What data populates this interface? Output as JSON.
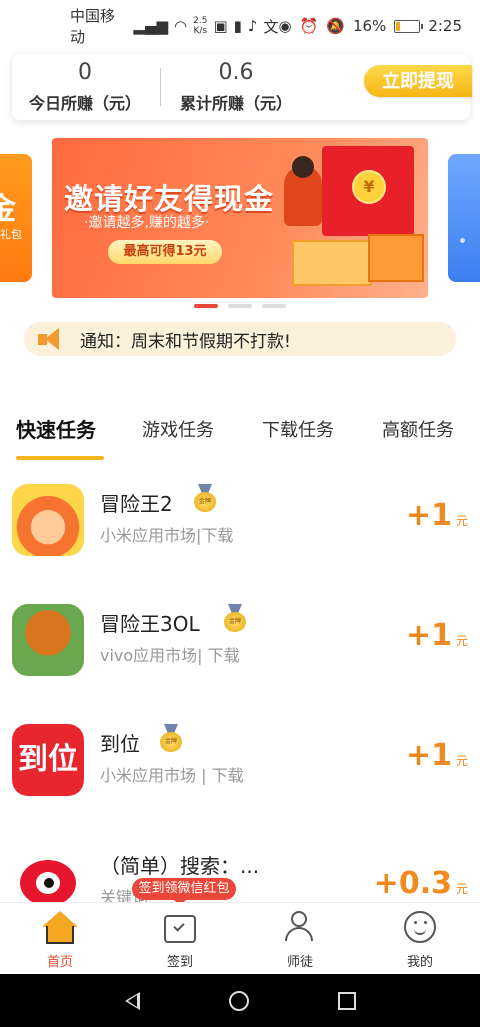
{
  "status_bar": {
    "carrier": "中国移动",
    "net_type": "4G",
    "speed_value": "2.5",
    "speed_unit": "K/s",
    "battery_percent": "16%",
    "battery_level": 0.16,
    "time": "2:25"
  },
  "earnings": {
    "today_value": "0",
    "today_label": "今日所赚（元）",
    "total_value": "0.6",
    "total_label": "累计所赚（元）",
    "withdraw_label": "立即提现"
  },
  "banner": {
    "left_card_text": "金",
    "left_card_sub": "礼包",
    "title": "邀请好友得现金",
    "subtitle": "·邀请越多,赚的越多·",
    "button": "最高可得13元",
    "coin_symbol": "¥",
    "active_index": 0
  },
  "notice": {
    "text": "通知：周末和节假期不打款!"
  },
  "tabs": [
    {
      "label": "快速任务",
      "active": true
    },
    {
      "label": "游戏任务",
      "active": false
    },
    {
      "label": "下载任务",
      "active": false
    },
    {
      "label": "高额任务",
      "active": false
    }
  ],
  "medal_text": "金牌",
  "tasks": [
    {
      "name": "冒险王2",
      "source": "小米应用市场|下载",
      "reward": "+1",
      "unit": "元",
      "icon": "maoxianwang2-icon"
    },
    {
      "name": "冒险王3OL",
      "source": "vivo应用市场| 下载",
      "reward": "+1",
      "unit": "元",
      "icon": "maoxianwang3-icon"
    },
    {
      "name": "到位",
      "source": "小米应用市场 | 下载",
      "reward": "+1",
      "unit": "元",
      "icon": "daowei-icon",
      "icon_text": "到位"
    },
    {
      "name": "（简单）搜索：...",
      "source": "关键词",
      "reward": "+0.3",
      "unit": "元",
      "icon": "weibo-icon"
    }
  ],
  "tooltip": "签到领微信红包",
  "bottom_nav": [
    {
      "label": "首页",
      "icon": "home-icon",
      "active": true
    },
    {
      "label": "签到",
      "icon": "calendar-check-icon",
      "active": false
    },
    {
      "label": "师徒",
      "icon": "add-user-icon",
      "active": false
    },
    {
      "label": "我的",
      "icon": "smile-icon",
      "active": false
    }
  ],
  "colors": {
    "accent_orange": "#f08a1c",
    "active_red": "#e6492d",
    "tab_underline": "#f7b520"
  }
}
